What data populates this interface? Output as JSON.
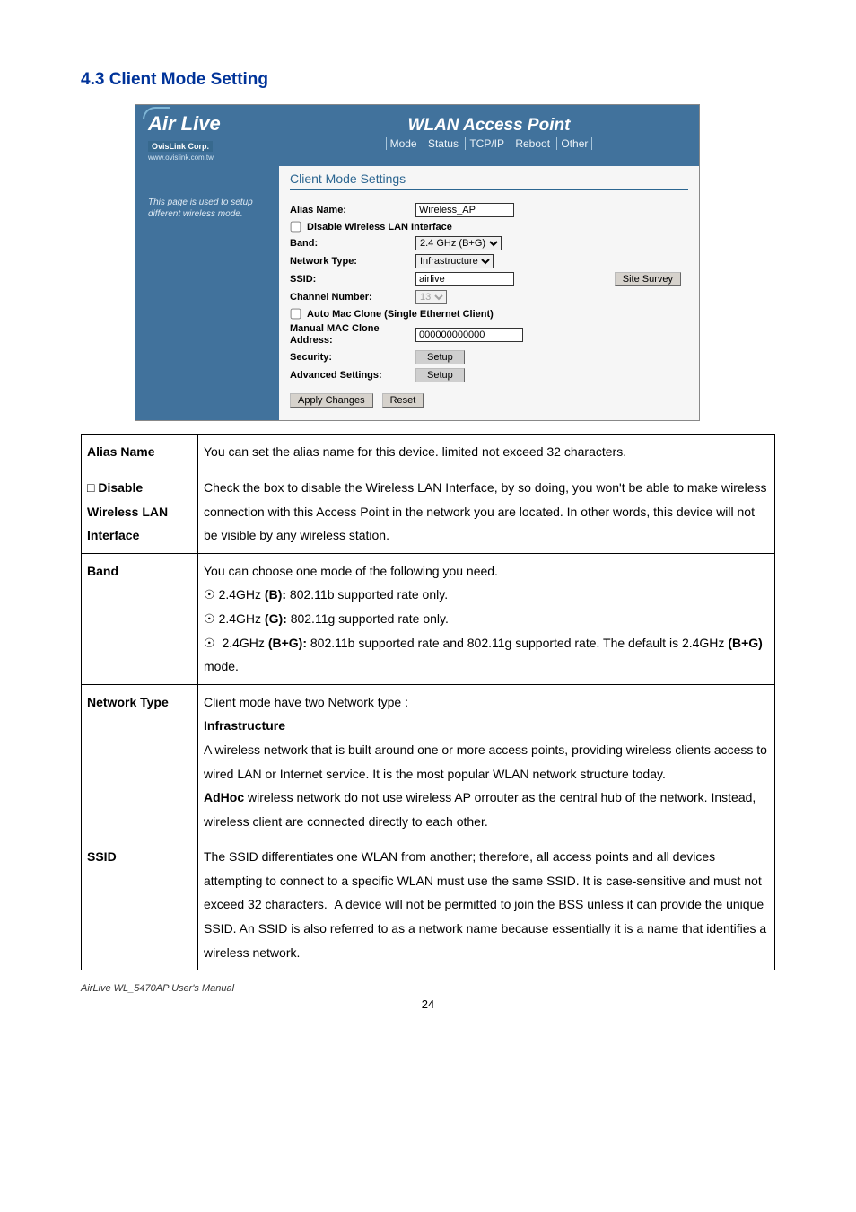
{
  "heading": "4.3 Client Mode Setting",
  "logo": {
    "brand": "Air Live",
    "company": "OvisLink Corp.",
    "url": "www.ovislink.com.tw"
  },
  "header": {
    "title": "WLAN Access Point",
    "nav": [
      "Mode",
      "Status",
      "TCP/IP",
      "Reboot",
      "Other"
    ]
  },
  "side_note": "This page is used to setup different wireless mode.",
  "form": {
    "title": "Client Mode Settings",
    "alias_label": "Alias Name:",
    "alias_value": "Wireless_AP",
    "disable_label": "Disable Wireless LAN Interface",
    "band_label": "Band:",
    "band_value": "2.4 GHz (B+G)",
    "nettype_label": "Network Type:",
    "nettype_value": "Infrastructure",
    "ssid_label": "SSID:",
    "ssid_value": "airlive",
    "site_survey": "Site Survey",
    "channel_label": "Channel Number:",
    "channel_value": "13",
    "automac_label": "Auto Mac Clone (Single Ethernet Client)",
    "manmac_label": "Manual MAC Clone Address:",
    "manmac_value": "000000000000",
    "security_label": "Security:",
    "advanced_label": "Advanced Settings:",
    "setup_btn": "Setup",
    "apply_btn": "Apply Changes",
    "reset_btn": "Reset"
  },
  "table": {
    "rows": [
      {
        "key": "Alias Name",
        "html": "You can set the alias name for this device. limited not exceed 32 characters."
      },
      {
        "key": "□ Disable Wireless LAN Interface",
        "html": "Check the box to disable the Wireless LAN Interface, by so doing, you won't be able to make wireless connection with this Access Point in the network you are located. In other words, this device will not be visible by any wireless station."
      },
      {
        "key": "Band",
        "html": "You can choose one mode of the following you need.<br><span class='bullet'>☉</span>2.4GHz <b>(B):</b> 802.11b supported rate only.<br><span class='bullet'>☉</span>2.4GHz <b>(G):</b> 802.11g supported rate only.<br><span class='bullet'>☉</span> 2.4GHz <b>(B+G):</b> 802.11b supported rate and 802.11g supported rate. The default is 2.4GHz <b>(B+G)</b> mode."
      },
      {
        "key": "Network Type",
        "html": "Client mode have two Network type :<br><b>Infrastructure</b><br>A wireless network that is built around one or more access points, providing wireless clients access to wired LAN or Internet service. It is the most popular WLAN network structure today.<br><b>AdHoc</b> wireless network do not use wireless AP orrouter as the central hub of the network. Instead, wireless client are connected directly to each other."
      },
      {
        "key": "SSID",
        "html": "The SSID differentiates one WLAN from another; therefore, all access points and all devices attempting to connect to a specific WLAN must use the same SSID. It is case-sensitive and must not exceed 32 characters.&nbsp;&nbsp;A device will not be permitted to join the BSS unless it can provide the unique SSID. An SSID is also referred to as a network name because essentially it is a name that identifies a wireless network."
      }
    ]
  },
  "footer": "AirLive WL_5470AP User's Manual",
  "page_number": "24"
}
